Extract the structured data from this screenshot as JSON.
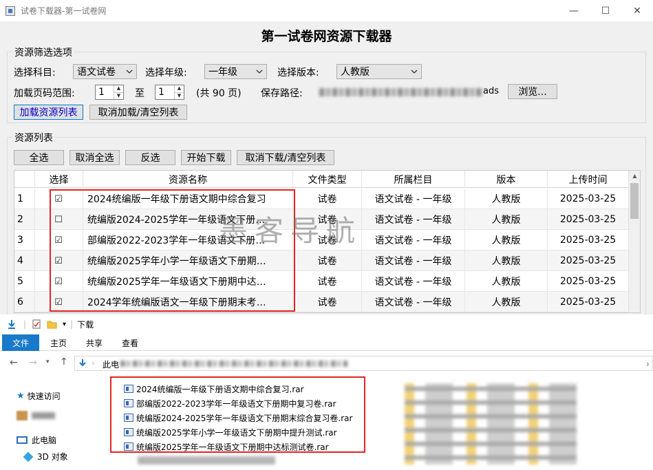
{
  "window": {
    "title": "试卷下载器-第一试卷网"
  },
  "heading": "第一试卷网资源下载器",
  "filter": {
    "legend": "资源筛选选项",
    "subject_label": "选择科目:",
    "subject_value": "语文试卷",
    "grade_label": "选择年级:",
    "grade_value": "一年级",
    "edition_label": "选择版本:",
    "edition_value": "人教版",
    "page_range_label": "加载页码范围:",
    "page_from": "1",
    "to_label": "至",
    "page_to": "1",
    "total_pages": "(共 90 页)",
    "save_path_label": "保存路径:",
    "save_path_visible_tail": "ads",
    "browse_label": "浏览...",
    "load_list_label": "加载资源列表",
    "cancel_load_label": "取消加载/清空列表"
  },
  "list": {
    "legend": "资源列表",
    "buttons": {
      "select_all": "全选",
      "deselect_all": "取消全选",
      "invert": "反选",
      "start_download": "开始下载",
      "cancel_download": "取消下载/清空列表"
    },
    "columns": [
      "选择",
      "资源名称",
      "文件类型",
      "所属栏目",
      "版本",
      "上传时间"
    ],
    "rows": [
      {
        "no": "1",
        "check": "☑",
        "name": "2024统编版一年级下册语文期中综合复习",
        "type": "试卷",
        "category": "语文试卷 - 一年级",
        "edition": "人教版",
        "date": "2025-03-25"
      },
      {
        "no": "2",
        "check": "☐",
        "name": "统编版2024-2025学年一年级语文下册…",
        "type": "试卷",
        "category": "语文试卷 - 一年级",
        "edition": "人教版",
        "date": "2025-03-25"
      },
      {
        "no": "3",
        "check": "☑",
        "name": "部编版2022-2023学年一年级语文下册…",
        "type": "试卷",
        "category": "语文试卷 - 一年级",
        "edition": "人教版",
        "date": "2025-03-25"
      },
      {
        "no": "4",
        "check": "☑",
        "name": "统编版2025学年小学一年级语文下册期…",
        "type": "试卷",
        "category": "语文试卷 - 一年级",
        "edition": "人教版",
        "date": "2025-03-25"
      },
      {
        "no": "5",
        "check": "☑",
        "name": "统编版2025学年一年级语文下册期中达…",
        "type": "试卷",
        "category": "语文试卷 - 一年级",
        "edition": "人教版",
        "date": "2025-03-25"
      },
      {
        "no": "6",
        "check": "☑",
        "name": "2024学年统编版语文一年级下册期末考…",
        "type": "试卷",
        "category": "语文试卷 - 一年级",
        "edition": "人教版",
        "date": "2025-03-25"
      }
    ]
  },
  "watermark": "墨客导航",
  "explorer": {
    "title": "下载",
    "tabs": [
      "文件",
      "主页",
      "共享",
      "查看"
    ],
    "address_prefix": "此电",
    "nav": {
      "quick_access": "快速访问",
      "this_pc": "此电脑",
      "objects_3d": "3D 对象"
    },
    "files": [
      "2024统编版一年级下册语文期中综合复习.rar",
      "部编版2022-2023学年一年级语文下册期中复习卷.rar",
      "统编版2024-2025学年一年级语文下册期末综合复习卷.rar",
      "统编版2025学年小学一年级语文下册期中提升测试.rar",
      "统编版2025学年一年级语文下册期中达标测试卷.rar"
    ]
  },
  "colors": {
    "accent": "#0078d7",
    "highlight_box": "#e02424",
    "file_tab": "#1979ca"
  }
}
